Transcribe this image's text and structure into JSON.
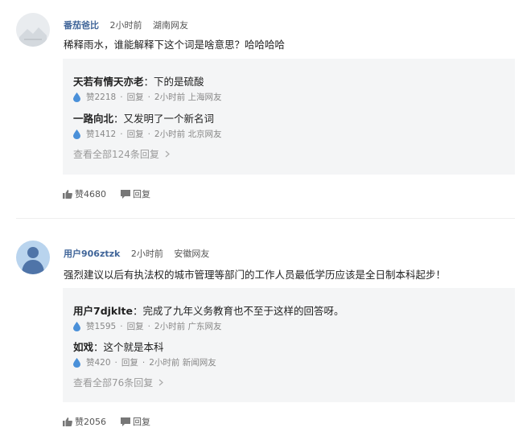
{
  "comments": [
    {
      "username": "番茄爸比",
      "time": "2小时前",
      "location": "湖南网友",
      "text": "稀释雨水，谁能解释下这个词是啥意思？哈哈哈哈",
      "replies": [
        {
          "user": "天若有情天亦老",
          "text": "：下的是硫酸",
          "likes": "赞2218",
          "reply": "回复",
          "time": "2小时前",
          "location": "上海网友"
        },
        {
          "user": "一路向北",
          "text": "：又发明了一个新名词",
          "likes": "赞1412",
          "reply": "回复",
          "time": "2小时前",
          "location": "北京网友"
        }
      ],
      "view_all": "查看全部124条回复",
      "likes": "赞4680",
      "reply_label": "回复"
    },
    {
      "username": "用户906ztzk",
      "time": "2小时前",
      "location": "安徽网友",
      "text": "强烈建议以后有执法权的城市管理等部门的工作人员最低学历应该是全日制本科起步！",
      "replies": [
        {
          "user": "用户7djklte",
          "text": "：完成了九年义务教育也不至于这样的回答呀。",
          "likes": "赞1595",
          "reply": "回复",
          "time": "2小时前",
          "location": "广东网友"
        },
        {
          "user": "如戏",
          "text": "：这个就是本科",
          "likes": "赞420",
          "reply": "回复",
          "time": "2小时前",
          "location": "新闻网友"
        }
      ],
      "view_all": "查看全部76条回复",
      "likes": "赞2056",
      "reply_label": "回复"
    }
  ],
  "colors": {
    "username": "#406599",
    "reply_bg": "#f4f5f6",
    "drop": "#4a90d9"
  },
  "icons": {
    "drop": "water-drop-icon",
    "thumb": "thumb-up-icon",
    "comment": "comment-bubble-icon",
    "chevron": "chevron-right-icon"
  }
}
